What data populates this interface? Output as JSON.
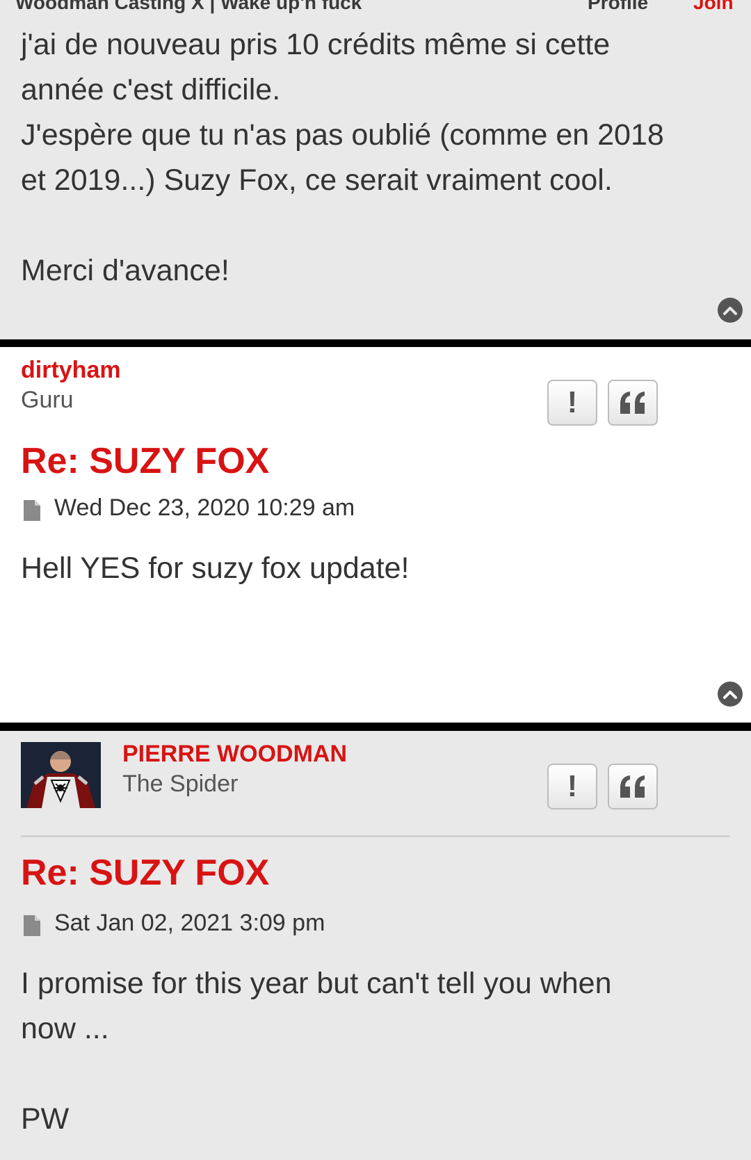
{
  "header": {
    "site_title": "Woodman Casting X | Wake up'n fuck",
    "profile_label": "Profile",
    "join_label": "Join"
  },
  "posts": [
    {
      "body_lines": [
        "j'ai de nouveau pris 10 crédits même si cette",
        "année c'est difficile.",
        "J'espère que tu n'as pas oublié (comme en 2018",
        "et 2019...) Suzy Fox, ce serait vraiment cool.",
        "",
        "Merci d'avance!"
      ]
    },
    {
      "author": "dirtyham",
      "rank": "Guru",
      "title": "Re: SUZY FOX",
      "date": "Wed Dec 23, 2020 10:29 am",
      "body_lines": [
        "Hell YES for suzy fox update!"
      ]
    },
    {
      "author": "PIERRE WOODMAN",
      "rank": "The Spider",
      "title": "Re: SUZY FOX",
      "date": "Sat Jan 02, 2021 3:09 pm",
      "body_lines": [
        "I promise for this year but can't tell you when",
        "now ...",
        "",
        "PW"
      ]
    }
  ],
  "icons": {
    "report": "exclamation-icon",
    "quote": "quote-icon",
    "back_to_top": "chevron-up-circle-icon",
    "post_link": "file-icon"
  },
  "colors": {
    "accent": "#d81313",
    "alt_background": "#e9e9e9",
    "white_background": "#ffffff",
    "separator": "#000000"
  }
}
